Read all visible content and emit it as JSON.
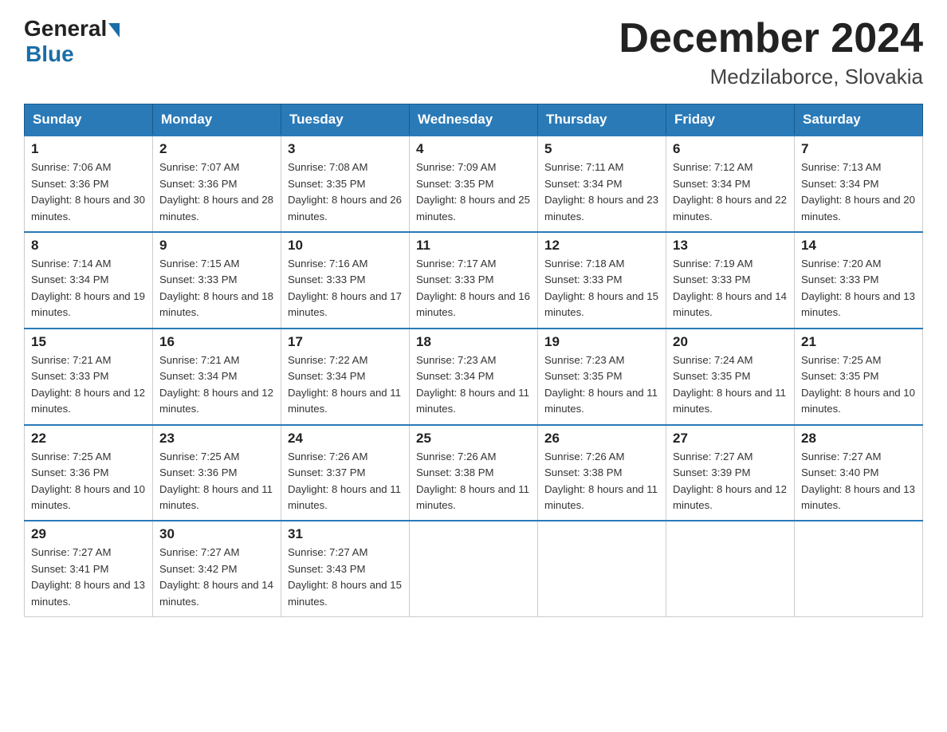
{
  "header": {
    "logo_general": "General",
    "logo_blue": "Blue",
    "title": "December 2024",
    "subtitle": "Medzilaborce, Slovakia"
  },
  "calendar": {
    "days_of_week": [
      "Sunday",
      "Monday",
      "Tuesday",
      "Wednesday",
      "Thursday",
      "Friday",
      "Saturday"
    ],
    "weeks": [
      [
        {
          "day": "1",
          "sunrise": "7:06 AM",
          "sunset": "3:36 PM",
          "daylight": "8 hours and 30 minutes."
        },
        {
          "day": "2",
          "sunrise": "7:07 AM",
          "sunset": "3:36 PM",
          "daylight": "8 hours and 28 minutes."
        },
        {
          "day": "3",
          "sunrise": "7:08 AM",
          "sunset": "3:35 PM",
          "daylight": "8 hours and 26 minutes."
        },
        {
          "day": "4",
          "sunrise": "7:09 AM",
          "sunset": "3:35 PM",
          "daylight": "8 hours and 25 minutes."
        },
        {
          "day": "5",
          "sunrise": "7:11 AM",
          "sunset": "3:34 PM",
          "daylight": "8 hours and 23 minutes."
        },
        {
          "day": "6",
          "sunrise": "7:12 AM",
          "sunset": "3:34 PM",
          "daylight": "8 hours and 22 minutes."
        },
        {
          "day": "7",
          "sunrise": "7:13 AM",
          "sunset": "3:34 PM",
          "daylight": "8 hours and 20 minutes."
        }
      ],
      [
        {
          "day": "8",
          "sunrise": "7:14 AM",
          "sunset": "3:34 PM",
          "daylight": "8 hours and 19 minutes."
        },
        {
          "day": "9",
          "sunrise": "7:15 AM",
          "sunset": "3:33 PM",
          "daylight": "8 hours and 18 minutes."
        },
        {
          "day": "10",
          "sunrise": "7:16 AM",
          "sunset": "3:33 PM",
          "daylight": "8 hours and 17 minutes."
        },
        {
          "day": "11",
          "sunrise": "7:17 AM",
          "sunset": "3:33 PM",
          "daylight": "8 hours and 16 minutes."
        },
        {
          "day": "12",
          "sunrise": "7:18 AM",
          "sunset": "3:33 PM",
          "daylight": "8 hours and 15 minutes."
        },
        {
          "day": "13",
          "sunrise": "7:19 AM",
          "sunset": "3:33 PM",
          "daylight": "8 hours and 14 minutes."
        },
        {
          "day": "14",
          "sunrise": "7:20 AM",
          "sunset": "3:33 PM",
          "daylight": "8 hours and 13 minutes."
        }
      ],
      [
        {
          "day": "15",
          "sunrise": "7:21 AM",
          "sunset": "3:33 PM",
          "daylight": "8 hours and 12 minutes."
        },
        {
          "day": "16",
          "sunrise": "7:21 AM",
          "sunset": "3:34 PM",
          "daylight": "8 hours and 12 minutes."
        },
        {
          "day": "17",
          "sunrise": "7:22 AM",
          "sunset": "3:34 PM",
          "daylight": "8 hours and 11 minutes."
        },
        {
          "day": "18",
          "sunrise": "7:23 AM",
          "sunset": "3:34 PM",
          "daylight": "8 hours and 11 minutes."
        },
        {
          "day": "19",
          "sunrise": "7:23 AM",
          "sunset": "3:35 PM",
          "daylight": "8 hours and 11 minutes."
        },
        {
          "day": "20",
          "sunrise": "7:24 AM",
          "sunset": "3:35 PM",
          "daylight": "8 hours and 11 minutes."
        },
        {
          "day": "21",
          "sunrise": "7:25 AM",
          "sunset": "3:35 PM",
          "daylight": "8 hours and 10 minutes."
        }
      ],
      [
        {
          "day": "22",
          "sunrise": "7:25 AM",
          "sunset": "3:36 PM",
          "daylight": "8 hours and 10 minutes."
        },
        {
          "day": "23",
          "sunrise": "7:25 AM",
          "sunset": "3:36 PM",
          "daylight": "8 hours and 11 minutes."
        },
        {
          "day": "24",
          "sunrise": "7:26 AM",
          "sunset": "3:37 PM",
          "daylight": "8 hours and 11 minutes."
        },
        {
          "day": "25",
          "sunrise": "7:26 AM",
          "sunset": "3:38 PM",
          "daylight": "8 hours and 11 minutes."
        },
        {
          "day": "26",
          "sunrise": "7:26 AM",
          "sunset": "3:38 PM",
          "daylight": "8 hours and 11 minutes."
        },
        {
          "day": "27",
          "sunrise": "7:27 AM",
          "sunset": "3:39 PM",
          "daylight": "8 hours and 12 minutes."
        },
        {
          "day": "28",
          "sunrise": "7:27 AM",
          "sunset": "3:40 PM",
          "daylight": "8 hours and 13 minutes."
        }
      ],
      [
        {
          "day": "29",
          "sunrise": "7:27 AM",
          "sunset": "3:41 PM",
          "daylight": "8 hours and 13 minutes."
        },
        {
          "day": "30",
          "sunrise": "7:27 AM",
          "sunset": "3:42 PM",
          "daylight": "8 hours and 14 minutes."
        },
        {
          "day": "31",
          "sunrise": "7:27 AM",
          "sunset": "3:43 PM",
          "daylight": "8 hours and 15 minutes."
        },
        null,
        null,
        null,
        null
      ]
    ]
  }
}
